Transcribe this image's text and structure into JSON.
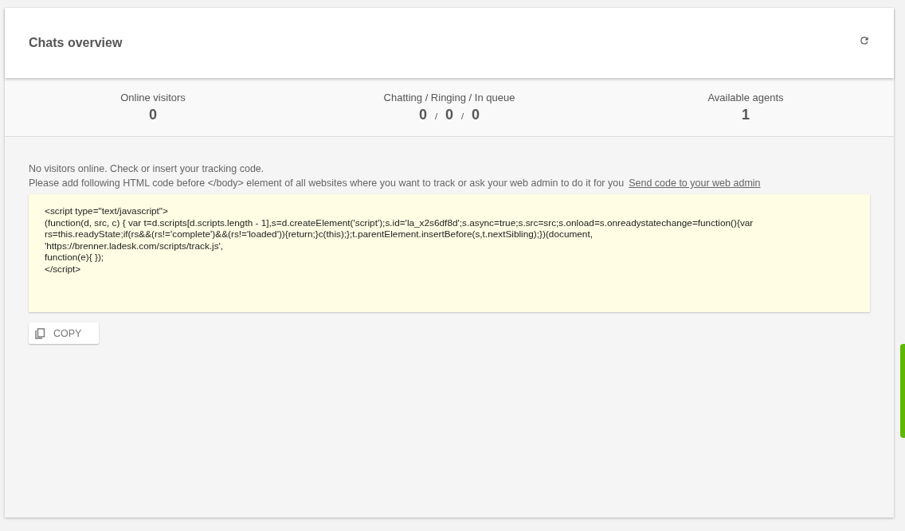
{
  "header": {
    "title": "Chats overview"
  },
  "stats": [
    {
      "label": "Online visitors",
      "values": [
        "0"
      ]
    },
    {
      "label": "Chatting / Ringing / In queue",
      "values": [
        "0",
        "0",
        "0"
      ],
      "separator": "/"
    },
    {
      "label": "Available agents",
      "values": [
        "1"
      ]
    }
  ],
  "notice": {
    "line_1": "No visitors online. Check or insert your tracking code.",
    "line_2": "Please add following HTML code before </body> element of all websites where you want to track or ask your web admin to do it for you",
    "link": "Send code to your web admin"
  },
  "code_lines": [
    "<script type=\"text/javascript\">",
    "(function(d, src, c) { var t=d.scripts[d.scripts.length - 1],s=d.createElement('script');s.id='la_x2s6df8d';s.async=true;s.src=src;s.onload=s.onreadystatechange=function(){var",
    "rs=this.readyState;if(rs&&(rs!='complete')&&(rs!='loaded')){return;}c(this);};t.parentElement.insertBefore(s,t.nextSibling);})(document,",
    "'https://brenner.ladesk.com/scripts/track.js',",
    "function(e){  });",
    "</script>"
  ],
  "copy_button": {
    "label": "COPY"
  }
}
